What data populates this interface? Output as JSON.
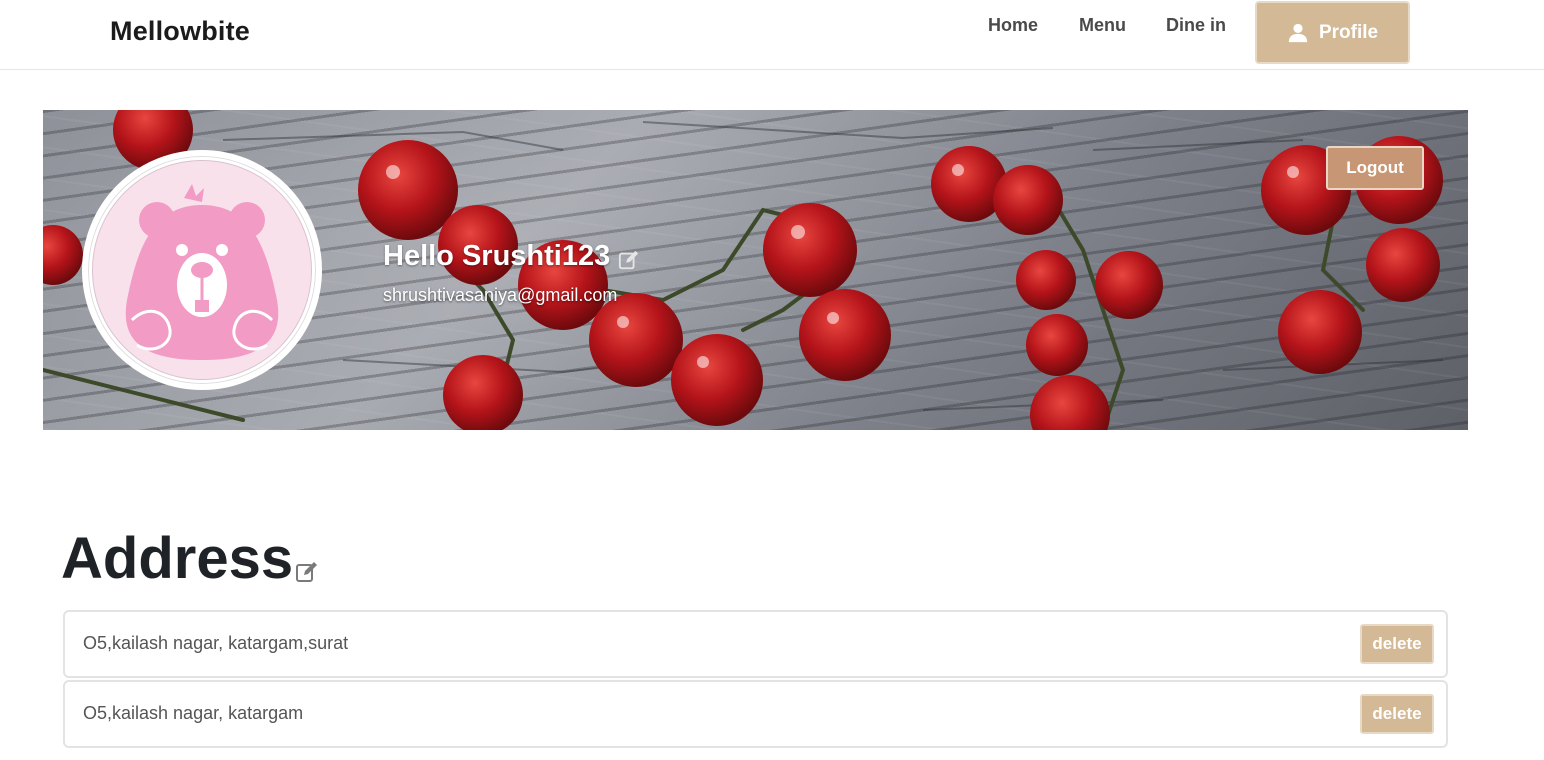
{
  "nav": {
    "brand": "Mellowbite",
    "links": [
      "Home",
      "Menu",
      "Dine in"
    ],
    "profile_label": "Profile",
    "profile_icon": "user-icon"
  },
  "banner": {
    "greeting": "Hello Srushti123",
    "email": "shrushtivasaniya@gmail.com",
    "logout_label": "Logout",
    "edit_icon": "edit-icon",
    "avatar_icon": "bear-avatar"
  },
  "address": {
    "heading": "Address",
    "edit_icon": "edit-icon",
    "items": [
      {
        "text": "O5,kailash nagar, katargam,surat",
        "delete_label": "delete"
      },
      {
        "text": "O5,kailash nagar, katargam",
        "delete_label": "delete"
      }
    ]
  },
  "colors": {
    "accent": "#d4b996",
    "logout": "#c79775",
    "avatar_pink": "#f29bc4",
    "avatar_bg": "#f9e1ec"
  }
}
